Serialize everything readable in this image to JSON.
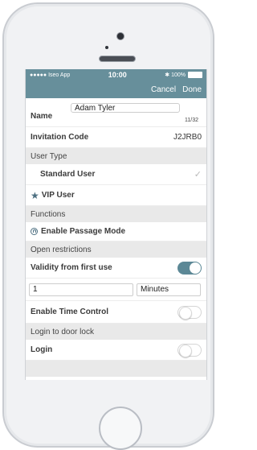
{
  "status_bar": {
    "carrier": "●●●●● Iseo App",
    "time": "10:00",
    "battery": "✱ 100%"
  },
  "nav": {
    "cancel_label": "Cancel",
    "done_label": "Done"
  },
  "form": {
    "name_label": "Name",
    "name_value": "Adam Tyler",
    "name_counter": "11/32",
    "invitation_label": "Invitation Code",
    "invitation_value": "J2JRB0",
    "user_type_header": "User Type",
    "standard_user_label": "Standard User",
    "standard_user_check": "✓",
    "vip_user_label": "VIP User",
    "functions_header": "Functions",
    "passage_mode_label": "Enable Passage Mode",
    "open_restrictions_header": "Open restrictions",
    "validity_label": "Validity from first use",
    "validity_toggle": "on",
    "validity_amount": "1",
    "validity_unit": "Minutes",
    "time_control_label": "Enable Time Control",
    "time_control_toggle": "off",
    "login_header": "Login to door lock",
    "login_label": "Login",
    "login_toggle": "off"
  },
  "colors": {
    "accent": "#678f9b",
    "toggle_on": "#5c8896"
  },
  "icons": {
    "vip": "star-icon",
    "passage": "lock-icon",
    "check": "checkmark-icon"
  }
}
